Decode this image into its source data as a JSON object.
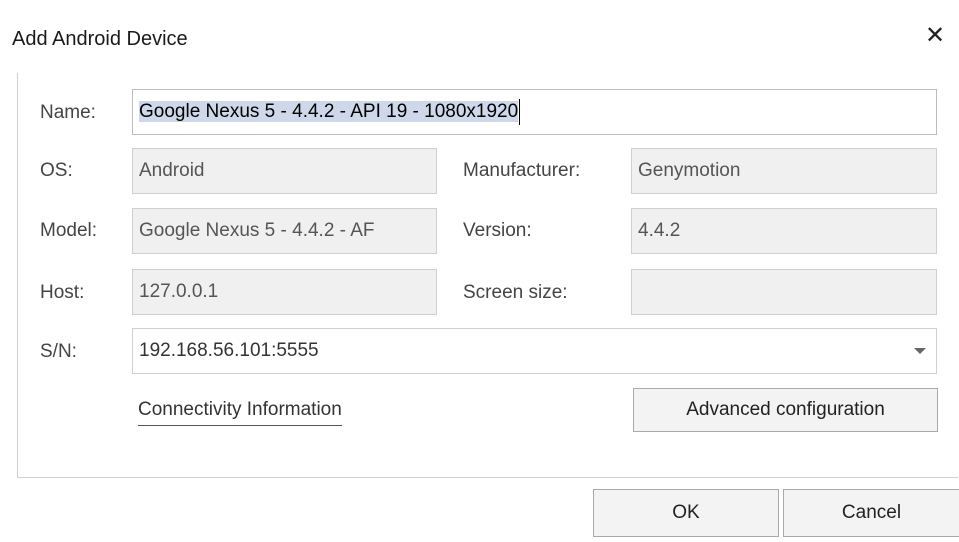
{
  "dialog": {
    "title": "Add Android Device",
    "close_glyph": "✕"
  },
  "form": {
    "name_label": "Name:",
    "name_selected": "Google Nexus 5 - 4.4.2 - API 19 - 1080x1920",
    "os_label": "OS:",
    "os_value": "Android",
    "manufacturer_label": "Manufacturer:",
    "manufacturer_value": "Genymotion",
    "model_label": "Model:",
    "model_value": "Google Nexus 5 - 4.4.2 - AF",
    "version_label": "Version:",
    "version_value": "4.4.2",
    "host_label": "Host:",
    "host_value": "127.0.0.1",
    "screen_size_label": "Screen size:",
    "screen_size_value": "",
    "sn_label": "S/N:",
    "sn_value": "192.168.56.101:5555"
  },
  "actions": {
    "connectivity_link": "Connectivity Information",
    "advanced_button": "Advanced configuration",
    "ok_button": "OK",
    "cancel_button": "Cancel"
  },
  "icons": {
    "close": "close-icon",
    "dropdown": "chevron-down-icon"
  },
  "colors": {
    "selection": "#cfd8ea",
    "readonly_field": "#f0f0f0",
    "border": "#cfcfcf"
  }
}
